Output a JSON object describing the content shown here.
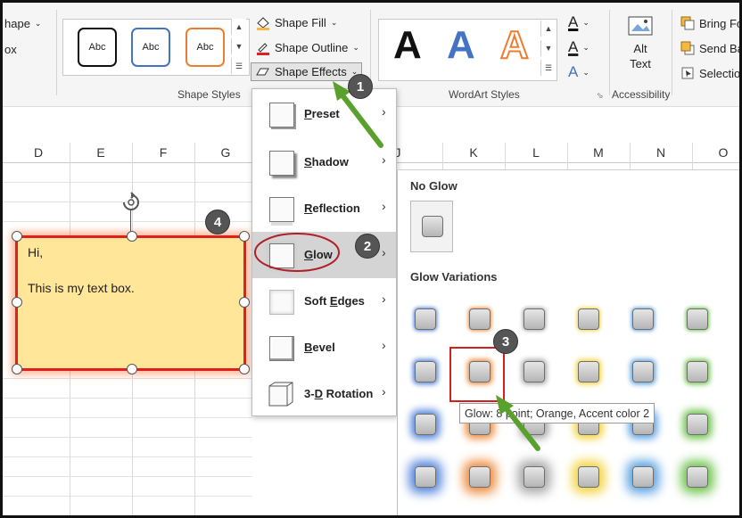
{
  "ribbon": {
    "left_cut": {
      "shape_label": "hape",
      "box_label": "ox"
    },
    "shape_styles": {
      "gallery": [
        "Abc",
        "Abc",
        "Abc"
      ],
      "group_label": "Shape Styles",
      "fill_label": "Shape Fill",
      "outline_label": "Shape Outline",
      "effects_label": "Shape Effects"
    },
    "wordart": {
      "letters": [
        "A",
        "A",
        "A"
      ],
      "group_label": "WordArt Styles",
      "text_letters": [
        "A",
        "A",
        "A"
      ]
    },
    "accessibility": {
      "alt_text_line1": "Alt",
      "alt_text_line2": "Text",
      "group_label": "Accessibility"
    },
    "arrange": {
      "bring_forward": "Bring Fo",
      "send_backward": "Send Ba",
      "selection": "Selectio"
    }
  },
  "sheet": {
    "columns": [
      "D",
      "E",
      "F",
      "G",
      "J",
      "K",
      "L",
      "M",
      "N",
      "O"
    ]
  },
  "textbox": {
    "line1": "Hi,",
    "line2": "This is my text box."
  },
  "menu": {
    "items": [
      {
        "label": "Preset",
        "underline": "P",
        "rest": "reset"
      },
      {
        "label": "Shadow",
        "underline": "S",
        "rest": "hadow"
      },
      {
        "label": "Reflection",
        "underline": "R",
        "rest": "eflection"
      },
      {
        "label": "Glow",
        "underline": "G",
        "rest": "low",
        "selected": true
      },
      {
        "label": "Soft Edges",
        "underline": "E",
        "pre": "Soft ",
        "rest": "dges"
      },
      {
        "label": "Bevel",
        "underline": "B",
        "rest": "evel"
      },
      {
        "label": "3-D Rotation",
        "underline": "D",
        "pre": "3-",
        "rest": " Rotation"
      }
    ]
  },
  "submenu": {
    "no_glow_label": "No Glow",
    "variations_label": "Glow Variations",
    "glow_colors": [
      "#4f81d9",
      "#ed8a3a",
      "#a5a5a5",
      "#f2d33b",
      "#5aa0e0",
      "#6cc24a"
    ],
    "tooltip": "Glow: 8 point; Orange, Accent color 2"
  },
  "callouts": [
    "1",
    "2",
    "3",
    "4"
  ],
  "colors": {
    "accent_arrow": "#5aa02c",
    "annotation_red": "#b0202a",
    "textbox_fill": "#ffe699",
    "textbox_border": "#e02020"
  }
}
